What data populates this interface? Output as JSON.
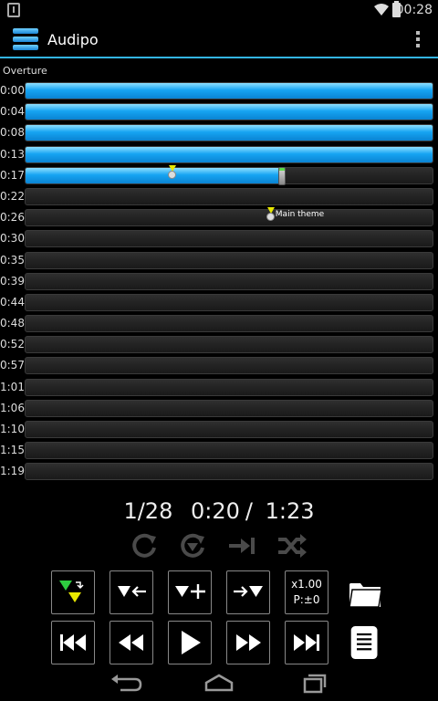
{
  "status_bar": {
    "time": "00:28"
  },
  "app": {
    "title": "Audipo"
  },
  "track": {
    "name": "Overture",
    "rows": [
      {
        "time": "0:00",
        "fill": 1.0
      },
      {
        "time": "0:04",
        "fill": 1.0
      },
      {
        "time": "0:08",
        "fill": 1.0
      },
      {
        "time": "0:13",
        "fill": 1.0
      },
      {
        "time": "0:17",
        "fill": 0.63
      },
      {
        "time": "0:22",
        "fill": 0
      },
      {
        "time": "0:26",
        "fill": 0
      },
      {
        "time": "0:30",
        "fill": 0
      },
      {
        "time": "0:35",
        "fill": 0
      },
      {
        "time": "0:39",
        "fill": 0
      },
      {
        "time": "0:44",
        "fill": 0
      },
      {
        "time": "0:48",
        "fill": 0
      },
      {
        "time": "0:52",
        "fill": 0
      },
      {
        "time": "0:57",
        "fill": 0
      },
      {
        "time": "1:01",
        "fill": 0
      },
      {
        "time": "1:06",
        "fill": 0
      },
      {
        "time": "1:10",
        "fill": 0
      },
      {
        "time": "1:15",
        "fill": 0
      },
      {
        "time": "1:19",
        "fill": 0
      }
    ],
    "markers": [
      {
        "row": 4,
        "fraction": 0.36,
        "label": ""
      },
      {
        "row": 6,
        "fraction": 0.6,
        "label": "Main theme"
      }
    ],
    "playhead": {
      "row": 4,
      "fraction": 0.63
    }
  },
  "player": {
    "track_position": "1/28",
    "elapsed": "0:20",
    "separator": "/",
    "duration": "1:23",
    "speed": "x1.00",
    "pitch": "P:±0"
  },
  "icons": {
    "repeat": "repeat-icon",
    "marker_repeat": "marker-repeat-icon",
    "skip_to_next_marker": "skip-to-marker-icon",
    "shuffle": "shuffle-icon",
    "add_marker": "add-marker-icon",
    "prev_marker": "prev-marker-icon",
    "next_marker": "next-marker-icon",
    "folder": "folder-icon",
    "playlist": "playlist-icon"
  },
  "colors": {
    "accent": "#33b5e5",
    "progress": "#16a4f2",
    "marker": "#e8e800",
    "playhead_top": "#5bdc4a"
  }
}
